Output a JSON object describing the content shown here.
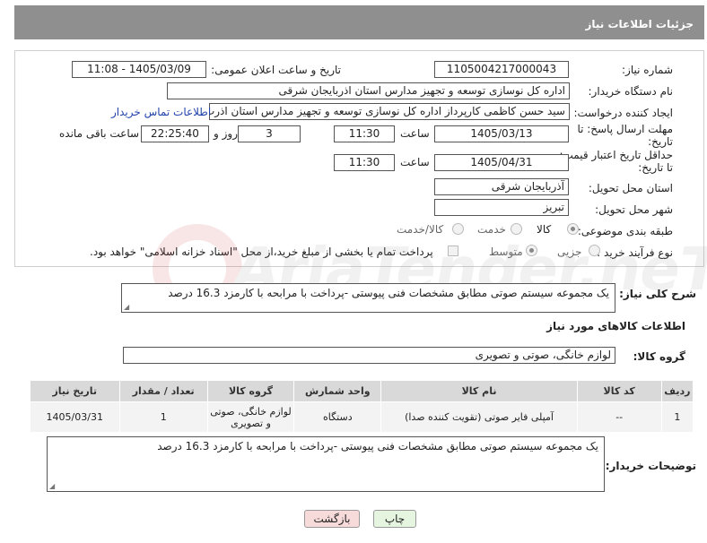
{
  "title": "جزئیات اطلاعات نیاز",
  "need_number": {
    "label": "شماره نیاز:",
    "value": "1105004217000043"
  },
  "announce": {
    "label": "تاریخ و ساعت اعلان عمومی:",
    "value": "1405/03/09 - 11:08"
  },
  "buyer": {
    "label": "نام دستگاه خریدار:",
    "value": "اداره کل نوسازی  توسعه و تجهیز مدارس استان اذربایجان شرقی"
  },
  "requester": {
    "label": "ایجاد کننده درخواست:",
    "value": "سید حسن کاظمی کارپرداز اداره کل نوسازی  توسعه و تجهیز مدارس استان اذرب",
    "contact_link": "اطلاعات تماس خریدار"
  },
  "deadline": {
    "label_line1": "مهلت ارسال پاسخ: تا",
    "label_line2": "تاریخ:",
    "date": "1405/03/13",
    "time_label": "ساعت",
    "time": "11:30",
    "days": "3",
    "days_label": "روز و",
    "remaining": "22:25:40",
    "remaining_label": "ساعت باقی مانده"
  },
  "price_validity": {
    "label_line1": "حداقل تاریخ اعتبار قیمت:",
    "label_line2": "تا تاریخ:",
    "date": "1405/04/31",
    "time_label": "ساعت",
    "time": "11:30"
  },
  "province": {
    "label": "استان محل تحویل:",
    "value": "آذربایجان شرقی"
  },
  "city": {
    "label": "شهر محل تحویل:",
    "value": "تبریز"
  },
  "category": {
    "label": "طبقه بندی موضوعی:",
    "options": [
      "کالا",
      "خدمت",
      "کالا/خدمت"
    ],
    "selected": "کالا"
  },
  "process": {
    "label": "نوع فرآیند خرید :",
    "options": [
      "جزیی",
      "متوسط"
    ],
    "selected": "متوسط",
    "payment_note": "پرداخت تمام یا بخشی از مبلغ خرید،از محل \"اسناد خزانه اسلامی\" خواهد بود."
  },
  "description": {
    "label": "شرح کلی نیاز:",
    "value": "یک مجموعه سیستم صوتی مطابق مشخصات فنی پیوستی -پرداخت با مرابحه با کارمزد 16.3 درصد"
  },
  "goods_info_title": "اطلاعات کالاهای مورد نیاز",
  "goods_group": {
    "label": "گروه کالا:",
    "value": "لوازم خانگی، صوتی و تصویری"
  },
  "table": {
    "headers": [
      "ردیف",
      "کد کالا",
      "نام کالا",
      "واحد شمارش",
      "گروه کالا",
      "تعداد / مقدار",
      "تاریخ نیاز"
    ],
    "rows": [
      [
        "1",
        "--",
        "آمپلی فایر صوتی (تقویت کننده صدا)",
        "دستگاه",
        "لوازم خانگی، صوتی و تصویری",
        "1",
        "1405/03/31"
      ]
    ]
  },
  "buyer_notes": {
    "label": "توضیحات خریدار:",
    "value": "یک مجموعه سیستم صوتی مطابق مشخصات فنی پیوستی -پرداخت با مرابحه با کارمزد 16.3 درصد"
  },
  "buttons": {
    "print": "چاپ",
    "back": "بازگشت"
  },
  "colors": {
    "title_bg": "#8f8f8f",
    "back_button": "#f7dada",
    "print_button": "#e6f5e0"
  }
}
